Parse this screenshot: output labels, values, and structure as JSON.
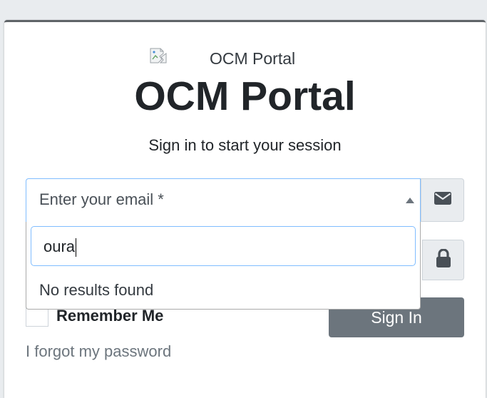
{
  "logo": {
    "alt_text": "OCM Portal",
    "icon": "broken-image-icon"
  },
  "title": "OCM Portal",
  "subtitle": "Sign in to start your session",
  "email_select": {
    "placeholder": "Enter your email *",
    "icon": "envelope-icon",
    "dropdown": {
      "search_value": "oura",
      "no_results_text": "No results found"
    }
  },
  "password": {
    "icon": "lock-icon"
  },
  "remember_me": {
    "label": "Remember Me",
    "checked": false
  },
  "sign_in_button": "Sign In",
  "forgot_password_link": "I forgot my password",
  "colors": {
    "page_background": "#e9ecef",
    "card_top_border": "#5f6468",
    "button_background": "#6c757d",
    "focus_border": "#80bdff",
    "link": "#6c757d"
  }
}
